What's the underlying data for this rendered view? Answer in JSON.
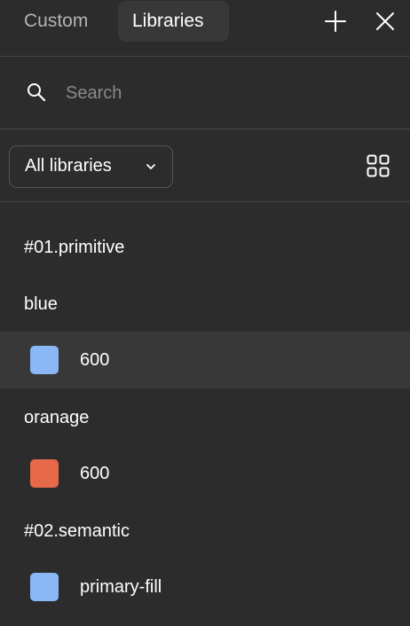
{
  "header": {
    "tabs": [
      {
        "label": "Custom",
        "active": false
      },
      {
        "label": "Libraries",
        "active": true
      }
    ],
    "add_icon": "plus-icon",
    "close_icon": "close-icon"
  },
  "search": {
    "placeholder": "Search",
    "value": "",
    "icon": "search-icon"
  },
  "filter": {
    "dropdown_label": "All libraries",
    "chevron_icon": "chevron-down-icon",
    "view_icon": "grid-view-icon"
  },
  "libraries": [
    {
      "heading": "#01.primitive",
      "groups": [
        {
          "heading": "blue",
          "items": [
            {
              "label": "600",
              "color": "#8ab8f6",
              "selected": true
            }
          ]
        },
        {
          "heading": "oranage",
          "items": [
            {
              "label": "600",
              "color": "#e8694a",
              "selected": false
            }
          ]
        }
      ]
    },
    {
      "heading": "#02.semantic",
      "groups": [
        {
          "heading": "",
          "items": [
            {
              "label": "primary-fill",
              "color": "#8ab8f6",
              "selected": false
            }
          ]
        }
      ]
    }
  ],
  "colors": {
    "background": "#2c2c2c",
    "selected_row": "#383838",
    "divider": "#444444",
    "muted_text": "#b3b3b3",
    "placeholder_text": "#8a8a8a"
  }
}
